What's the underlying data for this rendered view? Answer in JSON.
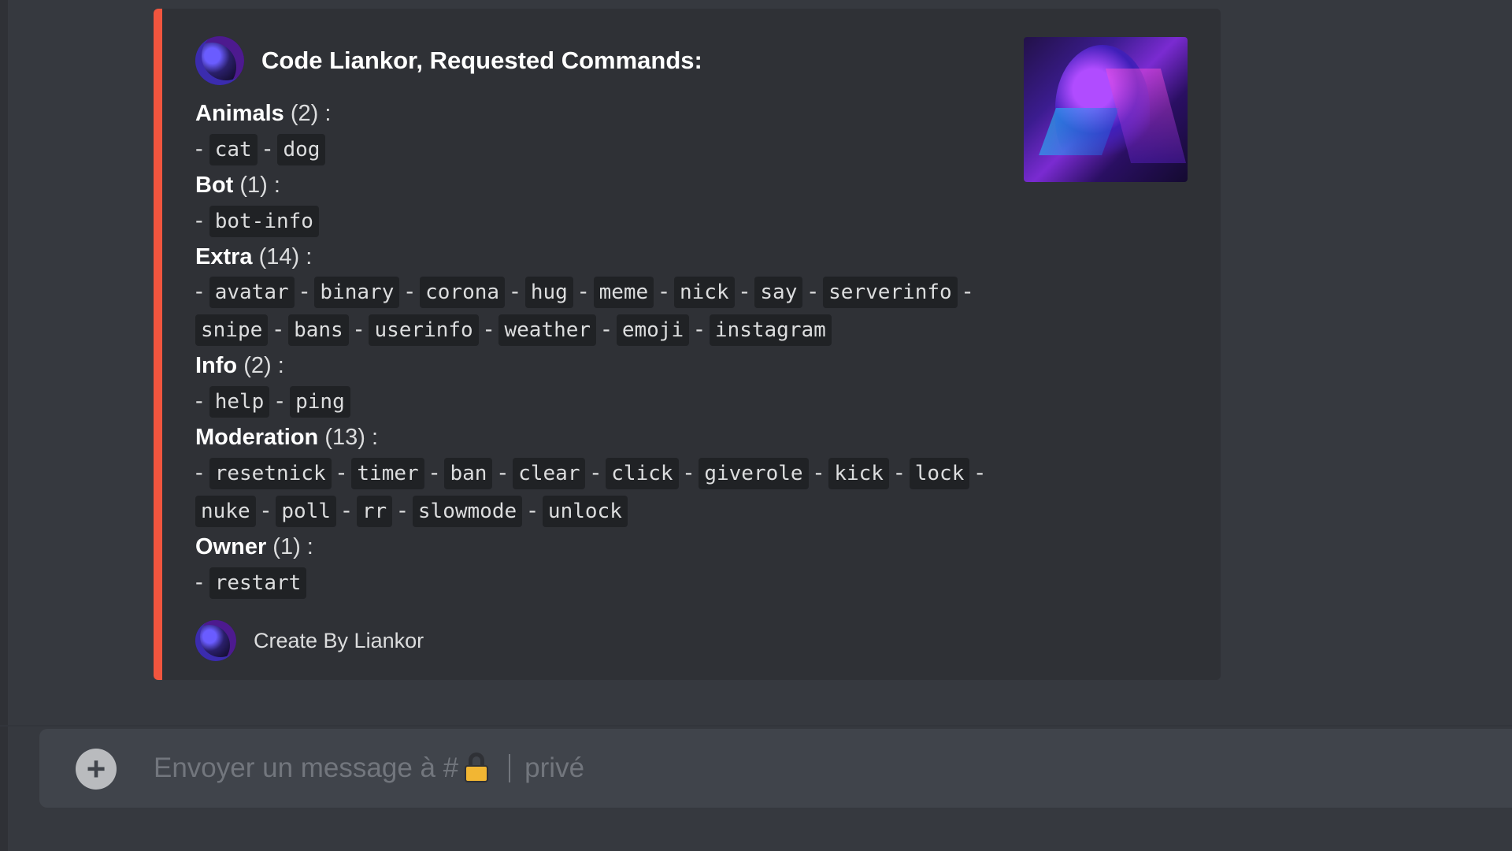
{
  "embed": {
    "accent_color": "#f1553e",
    "author": "Code Liankor, Requested Commands:",
    "categories": [
      {
        "name": "Animals",
        "count": "(2) :",
        "commands": [
          "cat",
          "dog"
        ]
      },
      {
        "name": "Bot",
        "count": "(1) :",
        "commands": [
          "bot-info"
        ]
      },
      {
        "name": "Extra",
        "count": "(14) :",
        "commands": [
          "avatar",
          "binary",
          "corona",
          "hug",
          "meme",
          "nick",
          "say",
          "serverinfo",
          "snipe",
          "bans",
          "userinfo",
          "weather",
          "emoji",
          "instagram"
        ]
      },
      {
        "name": "Info",
        "count": "(2) :",
        "commands": [
          "help",
          "ping"
        ]
      },
      {
        "name": "Moderation",
        "count": "(13) :",
        "commands": [
          "resetnick",
          "timer",
          "ban",
          "clear",
          "click",
          "giverole",
          "kick",
          "lock",
          "nuke",
          "poll",
          "rr",
          "slowmode",
          "unlock"
        ]
      },
      {
        "name": "Owner",
        "count": "(1) :",
        "commands": [
          "restart"
        ]
      }
    ],
    "footer": "Create By Liankor"
  },
  "composer": {
    "plus_icon": "plus-circle-icon",
    "placeholder_prefix": "Envoyer un message à #",
    "channel_icon": "lock-icon",
    "channel_suffix": "privé"
  }
}
